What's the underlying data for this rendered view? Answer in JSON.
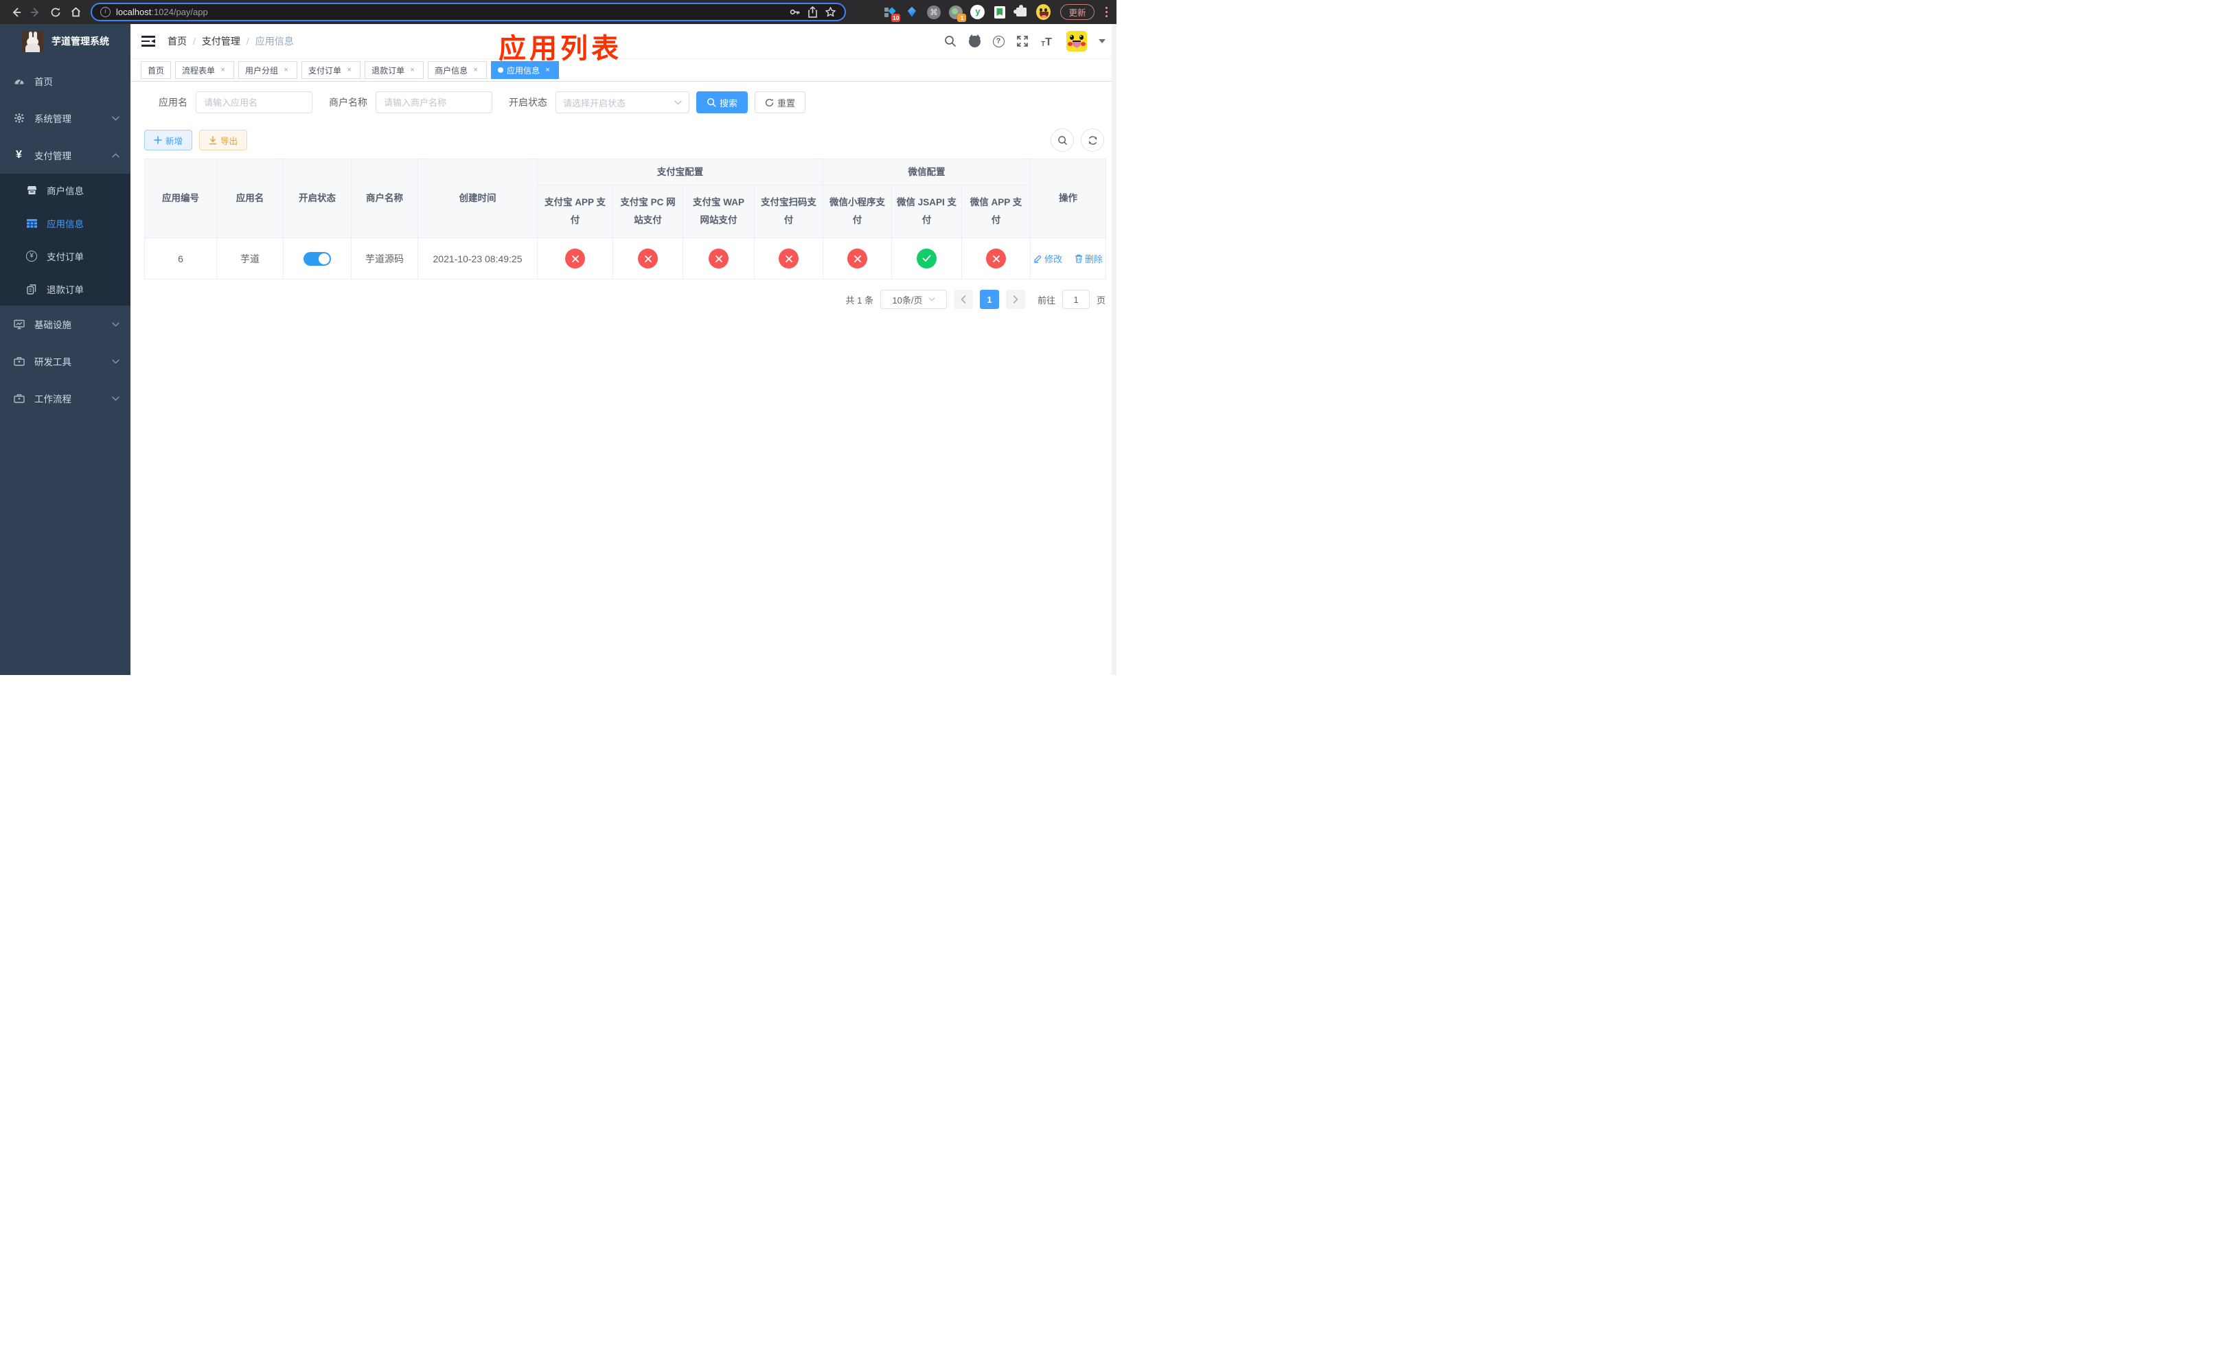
{
  "browser": {
    "url": {
      "host": "localhost",
      "path": ":1024/pay/app"
    },
    "update_label": "更新",
    "badge_10": "10",
    "badge_1": "1"
  },
  "sidebar": {
    "title": "芋道管理系统",
    "menu": [
      {
        "label": "首页"
      },
      {
        "label": "系统管理"
      },
      {
        "label": "支付管理"
      },
      {
        "label": "基础设施"
      },
      {
        "label": "研发工具"
      },
      {
        "label": "工作流程"
      }
    ],
    "submenu": [
      {
        "label": "商户信息"
      },
      {
        "label": "应用信息"
      },
      {
        "label": "支付订单"
      },
      {
        "label": "退款订单"
      }
    ]
  },
  "header": {
    "breadcrumb": [
      "首页",
      "支付管理",
      "应用信息"
    ],
    "annotation": "应用列表"
  },
  "tabs": [
    {
      "label": "首页",
      "closable": false,
      "active": false
    },
    {
      "label": "流程表单",
      "closable": true,
      "active": false
    },
    {
      "label": "用户分组",
      "closable": true,
      "active": false
    },
    {
      "label": "支付订单",
      "closable": true,
      "active": false
    },
    {
      "label": "退款订单",
      "closable": true,
      "active": false
    },
    {
      "label": "商户信息",
      "closable": true,
      "active": false
    },
    {
      "label": "应用信息",
      "closable": true,
      "active": true
    }
  ],
  "filters": {
    "app_name": {
      "label": "应用名",
      "placeholder": "请输入应用名",
      "value": ""
    },
    "merchant": {
      "label": "商户名称",
      "placeholder": "请输入商户名称",
      "value": ""
    },
    "status": {
      "label": "开启状态",
      "placeholder": "请选择开启状态",
      "value": ""
    },
    "search_label": "搜索",
    "reset_label": "重置"
  },
  "toolbar": {
    "add_label": "新增",
    "export_label": "导出"
  },
  "table": {
    "groups": {
      "alipay": "支付宝配置",
      "wechat": "微信配置"
    },
    "columns": {
      "id": "应用编号",
      "name": "应用名",
      "status": "开启状态",
      "merchant": "商户名称",
      "created": "创建时间",
      "alipay_app": "支付宝 APP 支付",
      "alipay_pc": "支付宝 PC 网站支付",
      "alipay_wap": "支付宝 WAP 网站支付",
      "alipay_qr": "支付宝扫码支付",
      "wx_mini": "微信小程序支付",
      "wx_jsapi": "微信 JSAPI 支付",
      "wx_app": "微信 APP 支付",
      "ops": "操作"
    },
    "row": {
      "id": "6",
      "name": "芋道",
      "enabled": true,
      "merchant": "芋道源码",
      "created": "2021-10-23 08:49:25",
      "channels": {
        "alipay_app": false,
        "alipay_pc": false,
        "alipay_wap": false,
        "alipay_qr": false,
        "wx_mini": false,
        "wx_jsapi": true,
        "wx_app": false
      },
      "edit_label": "修改",
      "delete_label": "删除"
    }
  },
  "pagination": {
    "total_label": "共 1 条",
    "page_size": "10条/页",
    "page": "1",
    "goto_label": "前往",
    "goto_value": "1",
    "unit": "页"
  },
  "colors": {
    "accent": "#409eff",
    "annotation": "#ff2f00",
    "success": "#13ce66",
    "danger": "#f85555",
    "warning": "#e6a23c",
    "sidebar_bg": "#304156",
    "submenu_bg": "#1f2d3d"
  }
}
